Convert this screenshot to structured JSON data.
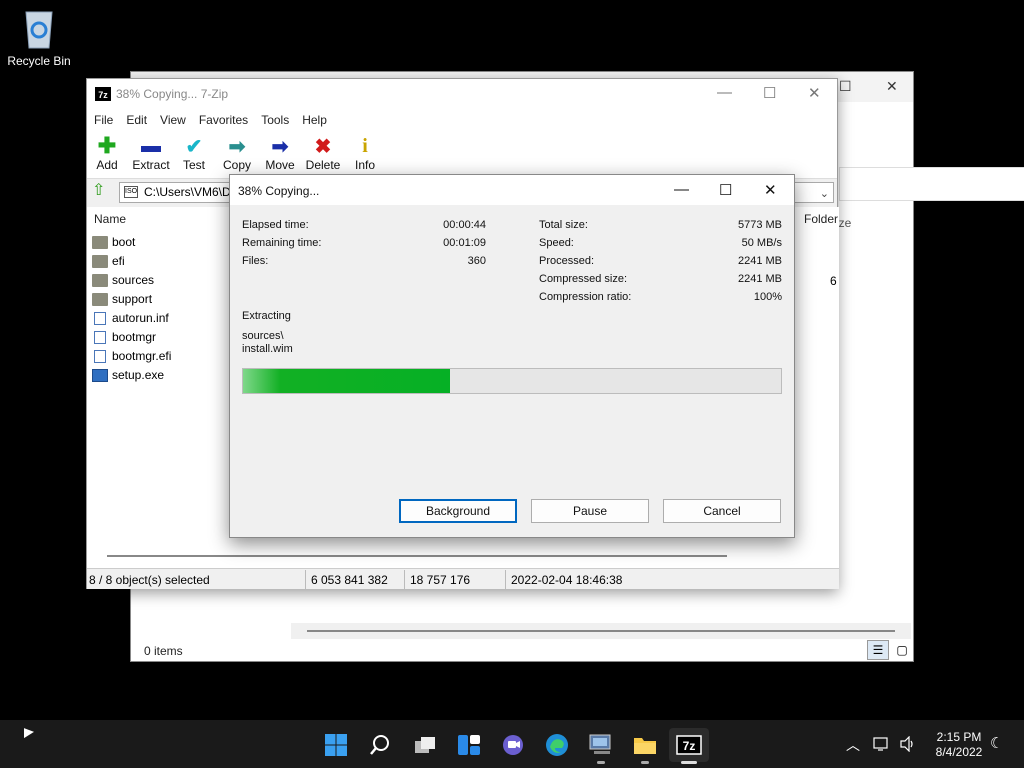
{
  "desktop": {
    "recycle_bin_label": "Recycle Bin"
  },
  "explorer": {
    "column_size": "ize",
    "status_items": "0 items"
  },
  "zip": {
    "title": "38% Copying... 7-Zip",
    "title_icon": "7z",
    "menu": [
      "File",
      "Edit",
      "View",
      "Favorites",
      "Tools",
      "Help"
    ],
    "toolbar": [
      {
        "label": "Add",
        "icon": "add-icon",
        "glyph": "✚",
        "color": "#1fa81f"
      },
      {
        "label": "Extract",
        "icon": "extract-icon",
        "glyph": "▬",
        "color": "#1a2fa8"
      },
      {
        "label": "Test",
        "icon": "test-icon",
        "glyph": "✔",
        "color": "#19b6c9"
      },
      {
        "label": "Copy",
        "icon": "copy-icon",
        "glyph": "➡",
        "color": "#2a8f8f"
      },
      {
        "label": "Move",
        "icon": "move-icon",
        "glyph": "➡",
        "color": "#1a2fa8"
      },
      {
        "label": "Delete",
        "icon": "delete-icon",
        "glyph": "✖",
        "color": "#d11a1a"
      },
      {
        "label": "Info",
        "icon": "info-icon",
        "glyph": "i",
        "color": "#c9a400"
      }
    ],
    "path": "C:\\Users\\VM6\\D",
    "column_name": "Name",
    "column_folder": "Folder",
    "folder_value": "6",
    "files": [
      {
        "name": "boot",
        "type": "folder"
      },
      {
        "name": "efi",
        "type": "folder"
      },
      {
        "name": "sources",
        "type": "folder"
      },
      {
        "name": "support",
        "type": "folder"
      },
      {
        "name": "autorun.inf",
        "type": "file"
      },
      {
        "name": "bootmgr",
        "type": "file"
      },
      {
        "name": "bootmgr.efi",
        "type": "file"
      },
      {
        "name": "setup.exe",
        "type": "exe"
      }
    ],
    "status": {
      "selected": "8 / 8 object(s) selected",
      "size": "6 053 841 382",
      "packed": "18 757 176",
      "modified": "2022-02-04 18:46:38"
    }
  },
  "dialog": {
    "title": "38% Copying...",
    "left_stats": [
      {
        "label": "Elapsed time:",
        "value": "00:00:44"
      },
      {
        "label": "Remaining time:",
        "value": "00:01:09"
      },
      {
        "label": "Files:",
        "value": "360"
      }
    ],
    "right_stats": [
      {
        "label": "Total size:",
        "value": "5773 MB"
      },
      {
        "label": "Speed:",
        "value": "50 MB/s"
      },
      {
        "label": "Processed:",
        "value": "2241 MB"
      },
      {
        "label": "Compressed size:",
        "value": "2241 MB"
      },
      {
        "label": "Compression ratio:",
        "value": "100%"
      }
    ],
    "operation": "Extracting",
    "current_dir": "sources\\",
    "current_file": "install.wim",
    "progress_fraction": 0.385,
    "buttons": {
      "background": "Background",
      "pause": "Pause",
      "cancel": "Cancel"
    }
  },
  "taskbar": {
    "time": "2:15 PM",
    "date": "8/4/2022"
  }
}
